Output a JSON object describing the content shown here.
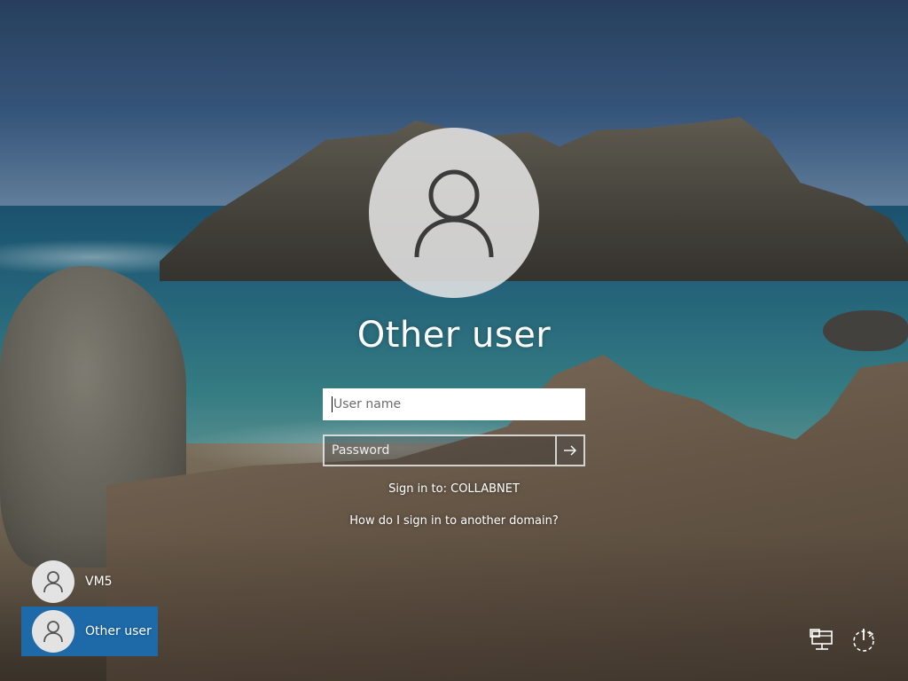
{
  "login": {
    "display_name": "Other user",
    "username_placeholder": "User name",
    "password_placeholder": "Password",
    "sign_in_to": "Sign in to: COLLABNET",
    "domain_help": "How do I sign in to another domain?"
  },
  "users": [
    {
      "label": "VM5",
      "selected": false
    },
    {
      "label": "Other user",
      "selected": true
    }
  ],
  "icons": {
    "avatar": "user-silhouette-icon",
    "submit": "arrow-right-icon",
    "network": "network-icon",
    "power": "power-icon"
  },
  "colors": {
    "selected_tile": "#1e6aa8",
    "text": "#ffffff",
    "avatar_circle": "#e3e3e3"
  }
}
